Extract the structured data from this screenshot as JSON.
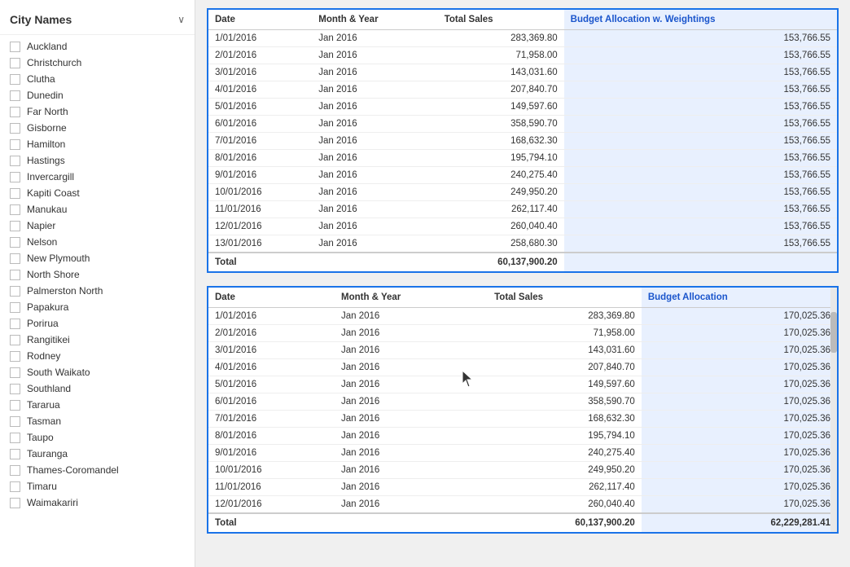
{
  "sidebar": {
    "title": "City Names",
    "chevron": "∨",
    "cities": [
      "Auckland",
      "Christchurch",
      "Clutha",
      "Dunedin",
      "Far North",
      "Gisborne",
      "Hamilton",
      "Hastings",
      "Invercargill",
      "Kapiti Coast",
      "Manukau",
      "Napier",
      "Nelson",
      "New Plymouth",
      "North Shore",
      "Palmerston North",
      "Papakura",
      "Porirua",
      "Rangitikei",
      "Rodney",
      "South Waikato",
      "Southland",
      "Tararua",
      "Tasman",
      "Taupo",
      "Tauranga",
      "Thames-Coromandel",
      "Timaru",
      "Waimakariri"
    ]
  },
  "table1": {
    "columns": [
      "Date",
      "Month & Year",
      "Total Sales",
      "Budget Allocation w. Weightings"
    ],
    "highlighted_col": 3,
    "rows": [
      [
        "1/01/2016",
        "Jan 2016",
        "283,369.80",
        "153,766.55"
      ],
      [
        "2/01/2016",
        "Jan 2016",
        "71,958.00",
        "153,766.55"
      ],
      [
        "3/01/2016",
        "Jan 2016",
        "143,031.60",
        "153,766.55"
      ],
      [
        "4/01/2016",
        "Jan 2016",
        "207,840.70",
        "153,766.55"
      ],
      [
        "5/01/2016",
        "Jan 2016",
        "149,597.60",
        "153,766.55"
      ],
      [
        "6/01/2016",
        "Jan 2016",
        "358,590.70",
        "153,766.55"
      ],
      [
        "7/01/2016",
        "Jan 2016",
        "168,632.30",
        "153,766.55"
      ],
      [
        "8/01/2016",
        "Jan 2016",
        "195,794.10",
        "153,766.55"
      ],
      [
        "9/01/2016",
        "Jan 2016",
        "240,275.40",
        "153,766.55"
      ],
      [
        "10/01/2016",
        "Jan 2016",
        "249,950.20",
        "153,766.55"
      ],
      [
        "11/01/2016",
        "Jan 2016",
        "262,117.40",
        "153,766.55"
      ],
      [
        "12/01/2016",
        "Jan 2016",
        "260,040.40",
        "153,766.55"
      ],
      [
        "13/01/2016",
        "Jan 2016",
        "258,680.30",
        "153,766.55"
      ]
    ],
    "footer": {
      "label": "Total",
      "total_sales": "60,137,900.20",
      "budget": ""
    }
  },
  "table2": {
    "columns": [
      "Date",
      "Month & Year",
      "Total Sales",
      "Budget Allocation"
    ],
    "highlighted_col": 3,
    "rows": [
      [
        "1/01/2016",
        "Jan 2016",
        "283,369.80",
        "170,025.36"
      ],
      [
        "2/01/2016",
        "Jan 2016",
        "71,958.00",
        "170,025.36"
      ],
      [
        "3/01/2016",
        "Jan 2016",
        "143,031.60",
        "170,025.36"
      ],
      [
        "4/01/2016",
        "Jan 2016",
        "207,840.70",
        "170,025.36"
      ],
      [
        "5/01/2016",
        "Jan 2016",
        "149,597.60",
        "170,025.36"
      ],
      [
        "6/01/2016",
        "Jan 2016",
        "358,590.70",
        "170,025.36"
      ],
      [
        "7/01/2016",
        "Jan 2016",
        "168,632.30",
        "170,025.36"
      ],
      [
        "8/01/2016",
        "Jan 2016",
        "195,794.10",
        "170,025.36"
      ],
      [
        "9/01/2016",
        "Jan 2016",
        "240,275.40",
        "170,025.36"
      ],
      [
        "10/01/2016",
        "Jan 2016",
        "249,950.20",
        "170,025.36"
      ],
      [
        "11/01/2016",
        "Jan 2016",
        "262,117.40",
        "170,025.36"
      ],
      [
        "12/01/2016",
        "Jan 2016",
        "260,040.40",
        "170,025.36"
      ]
    ],
    "footer": {
      "label": "Total",
      "total_sales": "60,137,900.20",
      "budget": "62,229,281.41"
    }
  }
}
